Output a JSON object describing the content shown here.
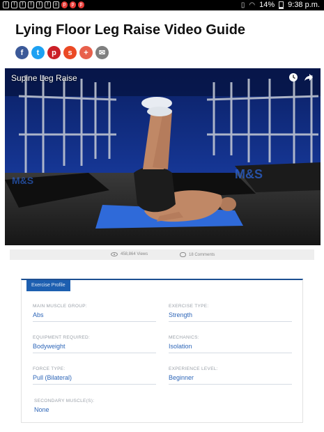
{
  "status_bar": {
    "notification_icons": [
      "f",
      "f",
      "f",
      "f",
      "f",
      "f",
      "o"
    ],
    "alert_icons": [
      "p",
      "p",
      "p"
    ],
    "battery": "14%",
    "time": "9:38 p.m."
  },
  "page": {
    "title": "Lying Floor Leg Raise Video Guide"
  },
  "share_buttons": [
    {
      "icon": "facebook-icon",
      "glyph": "f",
      "color": "#3b5998"
    },
    {
      "icon": "twitter-icon",
      "glyph": "t",
      "color": "#1da1f2"
    },
    {
      "icon": "pinterest-icon",
      "glyph": "p",
      "color": "#cb2027"
    },
    {
      "icon": "stumbleupon-icon",
      "glyph": "s",
      "color": "#eb4924"
    },
    {
      "icon": "plus-icon",
      "glyph": "+",
      "color": "#e8604c"
    },
    {
      "icon": "email-icon",
      "glyph": "✉",
      "color": "#7f7f7f"
    }
  ],
  "video": {
    "title": "Supine Leg Raise",
    "controls": [
      "watch-later-icon",
      "share-icon"
    ]
  },
  "stats": {
    "views": "458,864 Views",
    "comments": "18 Comments"
  },
  "exercise_profile": {
    "tab_label": "Exercise Profile",
    "fields": [
      {
        "label": "MAIN MUSCLE GROUP:",
        "value": "Abs"
      },
      {
        "label": "EXERCISE TYPE:",
        "value": "Strength"
      },
      {
        "label": "EQUIPMENT REQUIRED:",
        "value": "Bodyweight"
      },
      {
        "label": "MECHANICS:",
        "value": "Isolation"
      },
      {
        "label": "FORCE TYPE:",
        "value": "Pull (Bilateral)"
      },
      {
        "label": "EXPERIENCE LEVEL:",
        "value": "Beginner"
      },
      {
        "label": "SECONDARY MUSCLE(S):",
        "value": "None"
      }
    ]
  }
}
